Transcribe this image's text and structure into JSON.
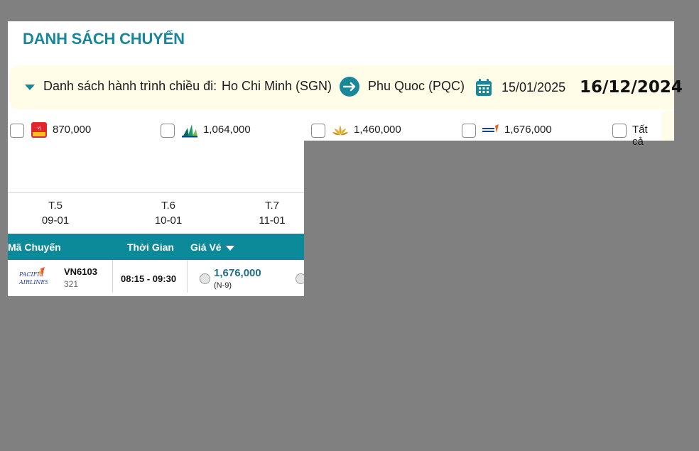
{
  "title": "DANH SÁCH CHUYẾN",
  "route": {
    "label": "Danh sách hành trình chiều đi:",
    "origin": "Ho Chi Minh (SGN)",
    "destination": "Phu Quoc (PQC)",
    "date": "15/01/2025",
    "date_overlay": "16/12/2024"
  },
  "airline_filters": [
    {
      "price": "870,000",
      "logo": "vietjet-logo"
    },
    {
      "price": "1,064,000",
      "logo": "bamboo-logo"
    },
    {
      "price": "1,460,000",
      "logo": "vietnam-airlines-logo"
    },
    {
      "price": "1,676,000",
      "logo": "pacific-airlines-logo"
    }
  ],
  "all_label": "Tất cả",
  "days": [
    {
      "dow": "T.5",
      "date": "09-01"
    },
    {
      "dow": "T.6",
      "date": "10-01"
    },
    {
      "dow": "T.7",
      "date": "11-01"
    }
  ],
  "table": {
    "headers": {
      "code": "Mã Chuyến",
      "time": "Thời Gian",
      "fare": "Giá Vé"
    },
    "rows": [
      {
        "logo_text_1": "PACIFIC",
        "logo_text_2": "AIRLINES",
        "code": "VN6103",
        "aircraft": "321",
        "time": "08:15 - 09:30",
        "fare": "1,676,000",
        "fare_class": "(N-9)"
      }
    ]
  },
  "colors": {
    "accent": "#18879a",
    "header": "#0d8a99",
    "fare": "#1f6e8c",
    "route_bg": "#fffde8"
  }
}
